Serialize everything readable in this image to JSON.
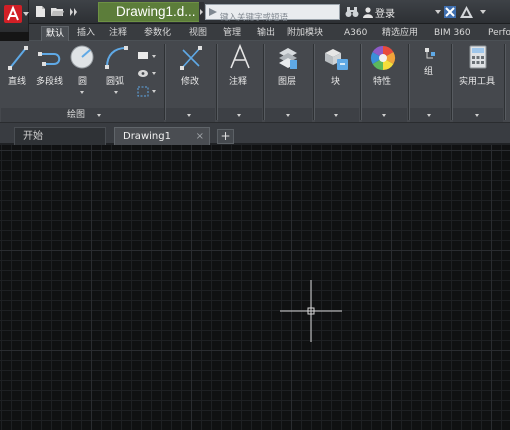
{
  "window": {
    "document_title": "Drawing1.d...",
    "search_placeholder": "键入关键字或短语",
    "login_label": "登录"
  },
  "ribbon_tabs": [
    "默认",
    "插入",
    "注释",
    "参数化",
    "视图",
    "管理",
    "输出",
    "附加模块",
    "A360",
    "精选应用",
    "BIM 360",
    "Perfo"
  ],
  "ribbon": {
    "draw_tools": [
      "直线",
      "多段线",
      "圆",
      "圆弧"
    ],
    "draw_panel_label": "绘图",
    "modify_label": "修改",
    "annotate_label": "注释",
    "layers_label": "图层",
    "block_label": "块",
    "properties_label": "特性",
    "group_label": "组",
    "utilities_label": "实用工具"
  },
  "file_tabs": {
    "start_label": "开始",
    "drawing_label": "Drawing1",
    "close_glyph": "×",
    "add_glyph": "+"
  },
  "colors": {
    "title_highlight": "#5c7d3a",
    "canvas_background": "#101112",
    "logo_red": "#d11f26"
  },
  "icons": [
    "autocad-logo",
    "new-file-icon",
    "open-folder-icon",
    "more-icon",
    "search-icon",
    "binoculars-icon",
    "user-icon",
    "exchange-icon",
    "autodesk-icon",
    "help-icon"
  ]
}
